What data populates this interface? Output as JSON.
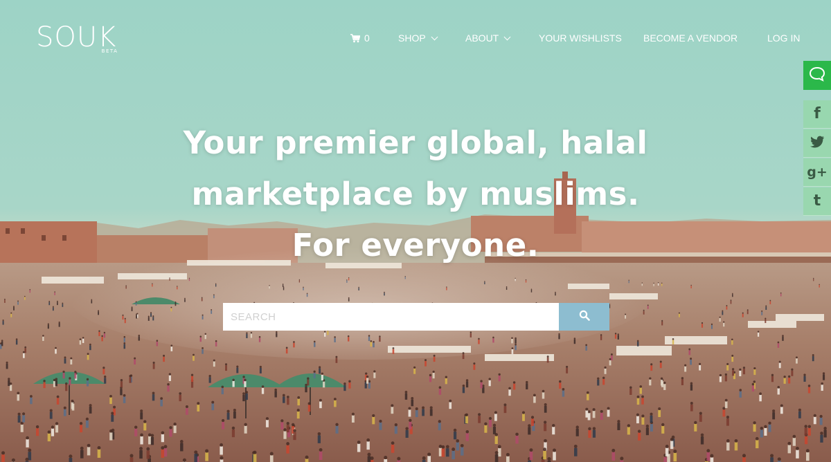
{
  "logo": {
    "word": "SOUK",
    "badge": "BETA"
  },
  "nav": {
    "cart_count": "0",
    "shop": "SHOP",
    "about": "ABOUT",
    "wishlists": "YOUR WISHLISTS",
    "vendor": "BECOME A VENDOR",
    "login": "LOG IN"
  },
  "hero": {
    "line1": "Your premier global, halal",
    "line2": "marketplace by muslims.",
    "line3": "For everyone."
  },
  "search": {
    "placeholder": "SEARCH"
  },
  "social": {
    "facebook": "f",
    "twitter": "twitter-icon",
    "googleplus": "g+",
    "tumblr": "t"
  },
  "colors": {
    "sky": "#9fd4c6",
    "search_button": "#8dbdd0",
    "chat_button": "#2bb84a",
    "social_bg": "#96d7aa"
  }
}
